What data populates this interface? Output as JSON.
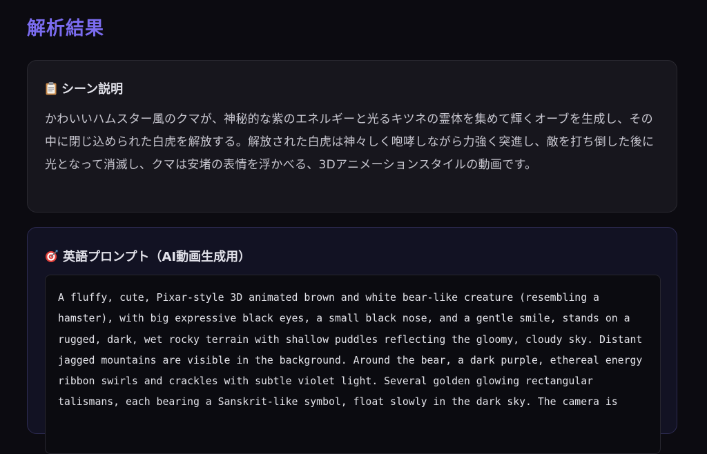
{
  "page": {
    "title": "解析結果"
  },
  "scene_section": {
    "icon": "clipboard-icon",
    "heading": "シーン説明",
    "body": "かわいいハムスター風のクマが、神秘的な紫のエネルギーと光るキツネの霊体を集めて輝くオーブを生成し、その中に閉じ込められた白虎を解放する。解放された白虎は神々しく咆哮しながら力強く突進し、敵を打ち倒した後に光となって消滅し、クマは安堵の表情を浮かべる、3Dアニメーションスタイルの動画です。"
  },
  "prompt_section": {
    "icon": "target-icon",
    "heading": "英語プロンプト（AI動画生成用）",
    "prompt_text": "A fluffy, cute, Pixar-style 3D animated brown and white bear-like creature (resembling a hamster), with big expressive black eyes, a small black nose, and a gentle smile, stands on a rugged, dark, wet rocky terrain with shallow puddles reflecting the gloomy, cloudy sky. Distant jagged mountains are visible in the background. Around the bear, a dark purple, ethereal energy ribbon swirls and crackles with subtle violet light. Several golden glowing rectangular talismans, each bearing a Sanskrit-like symbol, float slowly in the dark sky. The camera is"
  },
  "colors": {
    "background": "#0c0b11",
    "title_accent": "#7b6cf0",
    "card_scene_bg": "#17161d",
    "card_prompt_bg": "#121223",
    "card_prompt_border": "#2d2b52",
    "code_bg": "#0b0b10"
  }
}
